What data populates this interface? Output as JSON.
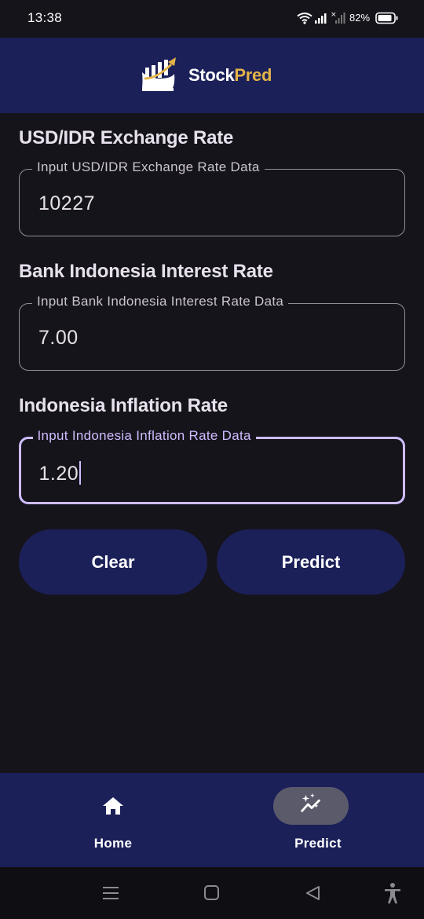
{
  "status_bar": {
    "time": "13:38",
    "battery": "82%",
    "icons": [
      "wifi-icon",
      "signal-icon",
      "no-signal-icon",
      "battery-icon"
    ]
  },
  "header": {
    "logo_icon": "chart-growth-icon",
    "brand_part1": "Stock",
    "brand_part2": "Pred",
    "colors": {
      "background": "#1b2059",
      "brand_accent": "#e3b348"
    }
  },
  "form": {
    "exchange": {
      "title": "USD/IDR Exchange Rate",
      "label": "Input USD/IDR Exchange Rate Data",
      "value": "10227"
    },
    "interest": {
      "title": "Bank Indonesia Interest Rate",
      "label": "Input Bank Indonesia Interest Rate Data",
      "value": "7.00"
    },
    "inflation": {
      "title": "Indonesia Inflation Rate",
      "label": "Input Indonesia Inflation Rate Data",
      "value": "1.20",
      "focused": true
    }
  },
  "buttons": {
    "clear": "Clear",
    "predict": "Predict"
  },
  "bottom_nav": {
    "items": [
      {
        "label": "Home",
        "icon": "home-icon",
        "active": false
      },
      {
        "label": "Predict",
        "icon": "sparkle-chart-icon",
        "active": true
      }
    ]
  },
  "system_nav": {
    "icons": [
      "menu-icon",
      "home-square-icon",
      "back-icon",
      "accessibility-icon"
    ]
  },
  "colors": {
    "background": "#16141b",
    "focus": "#cfbcff",
    "outline": "#938f99",
    "button": "#1b2059"
  }
}
